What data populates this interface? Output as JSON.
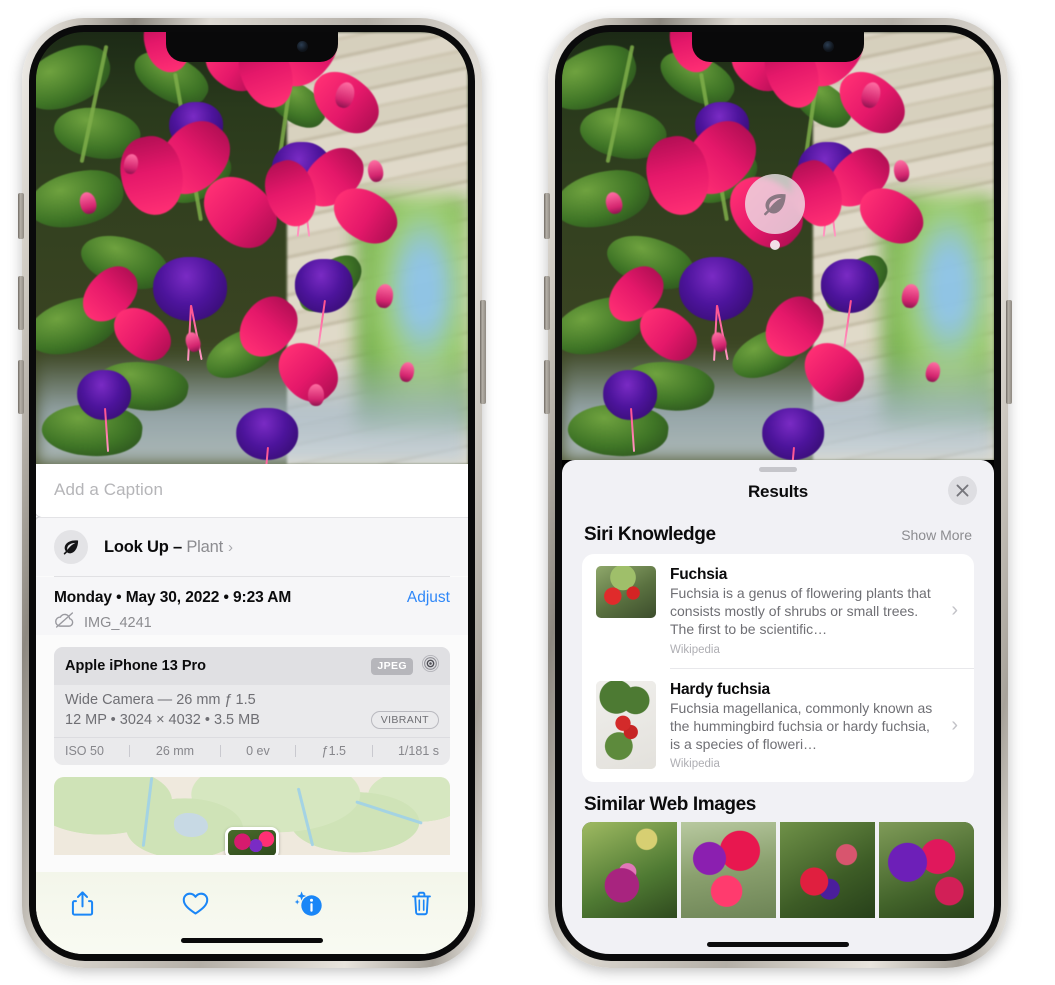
{
  "left_phone": {
    "caption_placeholder": "Add a Caption",
    "lookup": {
      "icon": "leaf-icon",
      "label": "Look Up – ",
      "subject": "Plant",
      "chevron": "›"
    },
    "meta": {
      "date": "Monday • May 30, 2022 • 9:23 AM",
      "adjust_label": "Adjust",
      "cloud_icon": "cloud-slash-icon",
      "filename": "IMG_4241"
    },
    "exif": {
      "device": "Apple iPhone 13 Pro",
      "format_badge": "JPEG",
      "lens_icon": "aperture-icon",
      "camera_line": "Wide Camera — 26 mm ƒ 1.5",
      "size_line": "12 MP • 3024 × 4032 • 3.5 MB",
      "style_pill": "VIBRANT",
      "stats": [
        "ISO 50",
        "26 mm",
        "0 ev",
        "ƒ1.5",
        "1/181 s"
      ]
    },
    "toolbar": [
      {
        "name": "share-icon",
        "label": "Share"
      },
      {
        "name": "heart-icon",
        "label": "Favorite"
      },
      {
        "name": "info-sparkle-icon",
        "label": "Info"
      },
      {
        "name": "trash-icon",
        "label": "Delete"
      }
    ]
  },
  "right_phone": {
    "visual_lookup_badge": "leaf-icon",
    "sheet": {
      "title": "Results",
      "close_icon": "close-icon"
    },
    "siri_knowledge": {
      "title": "Siri Knowledge",
      "show_more": "Show More",
      "cards": [
        {
          "title": "Fuchsia",
          "description": "Fuchsia is a genus of flowering plants that consists mostly of shrubs or small trees. The first to be scientific…",
          "source": "Wikipedia",
          "chevron": "›"
        },
        {
          "title": "Hardy fuchsia",
          "description": "Fuchsia magellanica, commonly known as the hummingbird fuchsia or hardy fuchsia, is a species of floweri…",
          "source": "Wikipedia",
          "chevron": "›"
        }
      ]
    },
    "similar_web_images": {
      "title": "Similar Web Images",
      "thumbs": [
        "web-image-1",
        "web-image-2",
        "web-image-3",
        "web-image-4"
      ]
    }
  },
  "colors": {
    "accent_blue": "#2f87f7",
    "sheet_bg": "#f1f1f5",
    "card_bg": "#ffffff",
    "secondary_text": "#8c8c90"
  }
}
